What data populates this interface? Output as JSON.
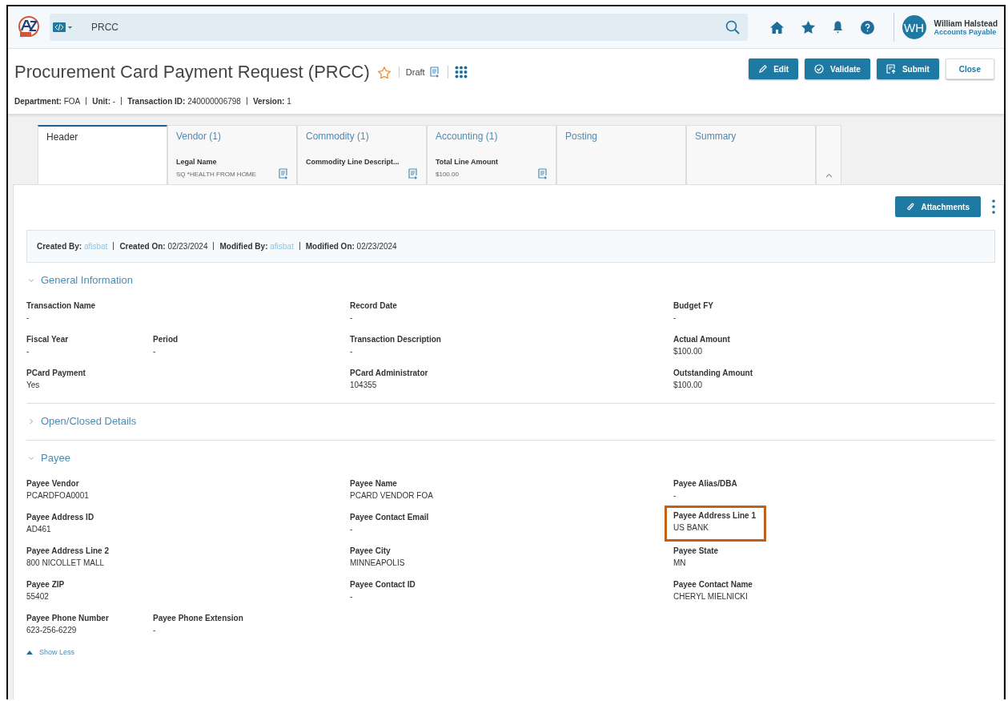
{
  "topbar": {
    "search_value": "PRCC",
    "user": {
      "initials": "WH",
      "name": "William Halstead",
      "role": "Accounts Payable"
    }
  },
  "page": {
    "title": "Procurement Card Payment Request (PRCC)",
    "favorite": false,
    "status": "Draft",
    "meta": [
      {
        "label": "Department:",
        "value": "FOA"
      },
      {
        "label": "Unit:",
        "value": "-"
      },
      {
        "label": "Transaction ID:",
        "value": "240000006798"
      },
      {
        "label": "Version:",
        "value": "1"
      }
    ],
    "buttons": [
      {
        "label": "Edit",
        "kind": "edit"
      },
      {
        "label": "Validate",
        "kind": "validate"
      },
      {
        "label": "Submit",
        "kind": "submit"
      },
      {
        "label": "Close",
        "kind": "plain"
      }
    ]
  },
  "tabs": [
    {
      "label": "Header",
      "selected": true
    },
    {
      "label": "Vendor (1)",
      "selected": false,
      "sub_label": "Legal Name",
      "sub_value": "SQ *HEALTH FROM HOME"
    },
    {
      "label": "Commodity (1)",
      "selected": false,
      "sub_label": "Commodity Line Descript..."
    },
    {
      "label": "Accounting (1)",
      "selected": false,
      "sub_label": "Total Line Amount",
      "sub_value": "$100.00"
    },
    {
      "label": "Posting",
      "selected": false
    },
    {
      "label": "Summary",
      "selected": false
    }
  ],
  "attachments_button": "Attachments",
  "audit": [
    {
      "label": "Created By:",
      "value": "afisbat",
      "kind": "link"
    },
    {
      "label": "Created On:",
      "value": "02/23/2024",
      "kind": "text"
    },
    {
      "label": "Modified By:",
      "value": "afisbat",
      "kind": "link"
    },
    {
      "label": "Modified On:",
      "value": "02/23/2024",
      "kind": "text"
    }
  ],
  "sections": [
    {
      "title": "General Information",
      "expanded": true,
      "rows": [
        [
          {
            "label": "Transaction Name",
            "value": "-"
          },
          null,
          {
            "label": "Record Date",
            "value": "-"
          },
          {
            "label": "Budget FY",
            "value": "-"
          }
        ],
        [
          {
            "label": "Fiscal Year",
            "value": "-"
          },
          {
            "label": "Period",
            "value": "-"
          },
          {
            "label": "Transaction Description",
            "value": "-"
          },
          {
            "label": "Actual Amount",
            "value": "$100.00"
          }
        ],
        [
          {
            "label": "PCard Payment",
            "value": "Yes"
          },
          null,
          {
            "label": "PCard Administrator",
            "value": "104355"
          },
          {
            "label": "Outstanding Amount",
            "value": "$100.00"
          }
        ]
      ]
    },
    {
      "title": "Open/Closed Details",
      "expanded": false
    },
    {
      "title": "Payee",
      "expanded": true,
      "rows": [
        [
          {
            "label": "Payee Vendor",
            "value": "PCARDFOA0001"
          },
          null,
          {
            "label": "Payee Name",
            "value": "PCARD VENDOR FOA"
          },
          {
            "label": "Payee Alias/DBA",
            "value": "-"
          }
        ],
        [
          {
            "label": "Payee Address ID",
            "value": "AD461"
          },
          null,
          {
            "label": "Payee Contact Email",
            "value": "-"
          },
          {
            "label": "Payee Address Line 1",
            "value": "US BANK",
            "highlighted": true
          }
        ],
        [
          {
            "label": "Payee Address Line 2",
            "value": "800 NICOLLET MALL"
          },
          null,
          {
            "label": "Payee City",
            "value": "MINNEAPOLIS"
          },
          {
            "label": "Payee State",
            "value": "MN"
          }
        ],
        [
          {
            "label": "Payee ZIP",
            "value": "55402"
          },
          null,
          {
            "label": "Payee Contact ID",
            "value": "-"
          },
          {
            "label": "Payee Contact Name",
            "value": "CHERYL MIELNICKI"
          }
        ],
        [
          {
            "label": "Payee Phone Number",
            "value": "623-256-6229"
          },
          {
            "label": "Payee Phone Extension",
            "value": "-"
          }
        ]
      ],
      "show_less": "Show Less"
    }
  ]
}
